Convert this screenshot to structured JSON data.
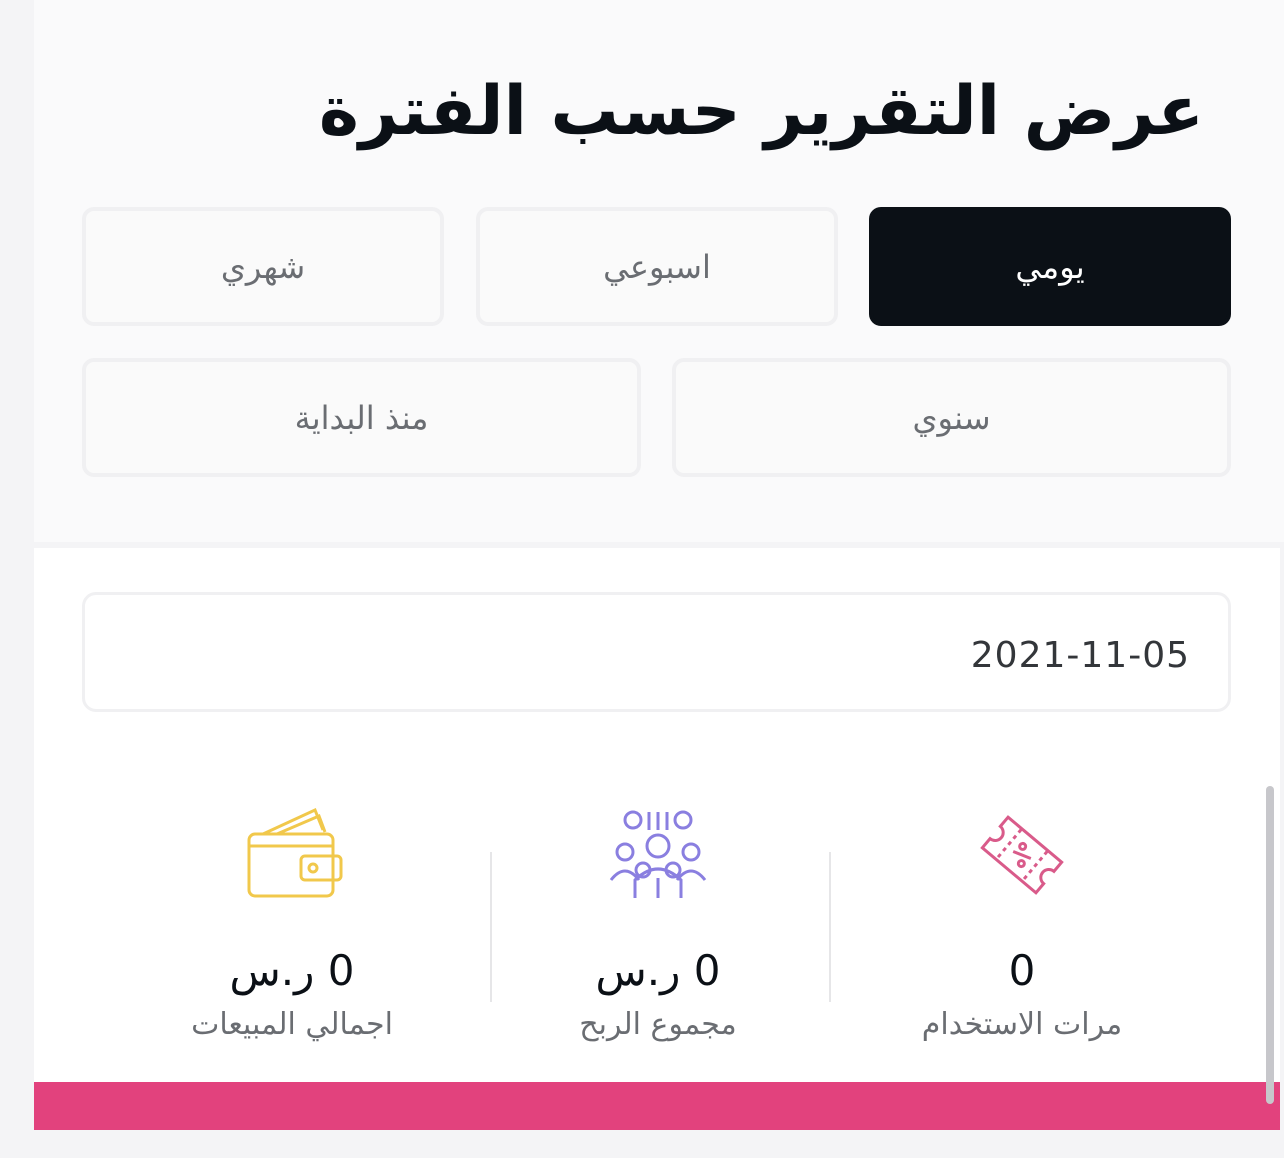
{
  "title": "عرض التقرير حسب الفترة",
  "periods": [
    {
      "label": "يومي",
      "active": true
    },
    {
      "label": "اسبوعي",
      "active": false
    },
    {
      "label": "شهري",
      "active": false
    },
    {
      "label": "سنوي",
      "active": false
    },
    {
      "label": "منذ البداية",
      "active": false
    }
  ],
  "date": {
    "value": "2021-11-05"
  },
  "stats": [
    {
      "icon": "coupon-icon",
      "value": "0",
      "label": "مرات الاستخدام",
      "color": "#d95b8a"
    },
    {
      "icon": "team-icon",
      "value": "0 ر.س",
      "label": "مجموع الربح",
      "color": "#8a7fe0"
    },
    {
      "icon": "wallet-icon",
      "value": "0 ر.س",
      "label": "اجمالي المبيعات",
      "color": "#f1c84b"
    }
  ],
  "colors": {
    "accent": "#e2427d",
    "active_button": "#0b1016"
  }
}
